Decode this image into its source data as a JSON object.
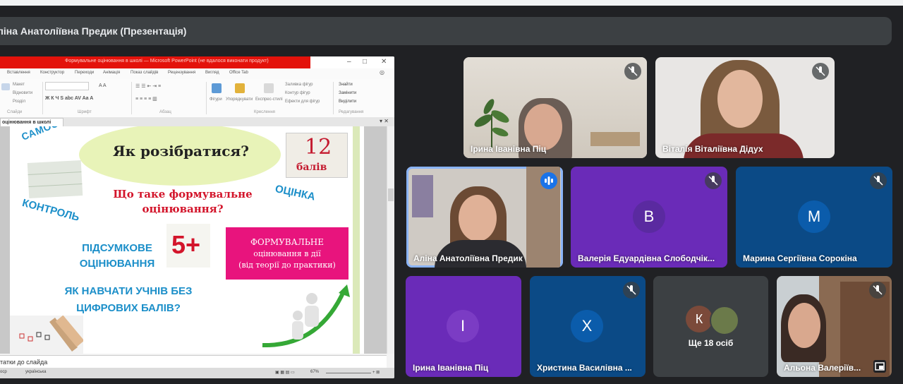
{
  "meeting": {
    "presentation_title": "ліна Анатоліївна Предик (Презентація)"
  },
  "powerpoint": {
    "window_title": "Формувальне оцінювання в школі — Microsoft PowerPoint (не вдалося виконати продукт)",
    "win_controls": {
      "minimize": "–",
      "maximize": "□",
      "close": "✕"
    },
    "tabs": [
      "Вставлення",
      "Конструктор",
      "Переходи",
      "Анімація",
      "Показ слайдів",
      "Рецензування",
      "Вигляд",
      "Office Tab"
    ],
    "ribbon_groups": [
      "Слайди",
      "Шрифт",
      "Абзац",
      "Креслення",
      "Редагування"
    ],
    "ribbon_items": {
      "layout": "Макет",
      "reset": "Відновити",
      "section": "Розділ",
      "shapes": "Фігури",
      "arrange": "Упорядкувати",
      "quick_styles": "Експрес-стилі",
      "fill": "Заливка фігур",
      "outline": "Контур фігур",
      "effects": "Ефекти для фігур",
      "find": "Знайти",
      "replace": "Замінити",
      "select": "Виділити"
    },
    "doc_tab": "оцінювання в школі",
    "notes_placeholder": "татки до слайда",
    "status": {
      "left": "оср",
      "lang": "українська",
      "zoom": "67%"
    }
  },
  "slide": {
    "title": "Як розібратися?",
    "samo": "САМООЦІН",
    "question": "Що таке формувальне оцінювання?",
    "ocinka": "ОЦІНКА",
    "kontrol": "КОНТРОЛЬ",
    "pidsumkove": "ПІДСУМКОВЕ ОЦІНЮВАННЯ",
    "grade5": "5+",
    "box_line1": "ФОРМУВАЛЬНЕ",
    "box_line2": "оцінювання в дії",
    "box_line3": "(від теорії до практики)",
    "yak_navchaty": "ЯК НАВЧАТИ УЧНІВ БЕЗ ЦИФРОВИХ БАЛІВ?",
    "img12_num": "12",
    "img12_word": "балів"
  },
  "participants": [
    {
      "name": "Ірина Іванівна Піц",
      "muted": true
    },
    {
      "name": "Віталія Віталіївна Дідух",
      "muted": true
    },
    {
      "name": "Аліна Анатоліївна Предик",
      "speaking": true
    },
    {
      "name": "Валерія Едуардівна Слободчік...",
      "initial": "В",
      "muted": true
    },
    {
      "name": "Марина Сергіївна Сорокіна",
      "initial": "М",
      "muted": true
    },
    {
      "name": "Ірина Іванівна Піц",
      "initial": "І"
    },
    {
      "name": "Христина Василівна ...",
      "initial": "Х",
      "muted": true
    },
    {
      "name": "Альона Валеріїв...",
      "muted": true
    }
  ],
  "others": {
    "initial": "К",
    "label": "Ще 18 осіб"
  },
  "colors": {
    "tile_purple": "#6a2bb8",
    "tile_blue": "#0b4a86",
    "tile_gray": "#3c4043",
    "speaking_border": "#8ab4f8"
  }
}
